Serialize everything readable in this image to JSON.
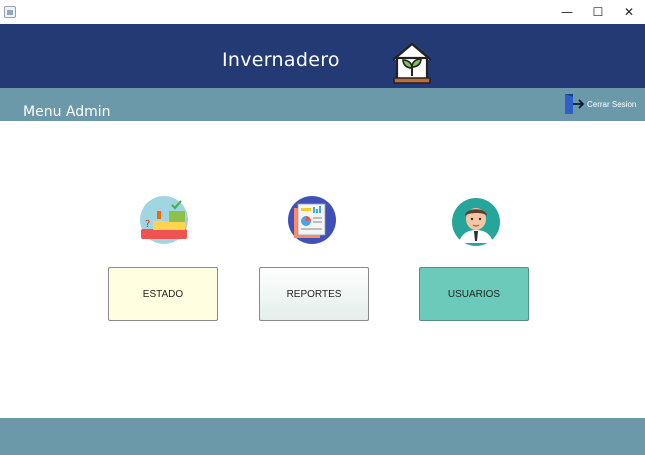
{
  "window": {
    "app_icon": "java-window-icon",
    "minimize_glyph": "—",
    "maximize_glyph": "☐",
    "close_glyph": "✕"
  },
  "header": {
    "title": "Invernadero",
    "logo_icon": "greenhouse-plant-icon",
    "background_color": "#233a75"
  },
  "subbar": {
    "title": "Menu Admin",
    "logout_label": "Cerrar Sesion",
    "logout_icon": "logout-door-icon",
    "background_color": "#6b99aa"
  },
  "cards": [
    {
      "icon": "status-steps-icon",
      "button_label": "ESTADO",
      "button_color": "#fffee0"
    },
    {
      "icon": "report-documents-icon",
      "button_label": "REPORTES",
      "button_color": "#eef5f2"
    },
    {
      "icon": "user-avatar-icon",
      "button_label": "USUARIOS",
      "button_color": "#6ccaba"
    }
  ],
  "footer": {
    "background_color": "#6b99aa"
  }
}
